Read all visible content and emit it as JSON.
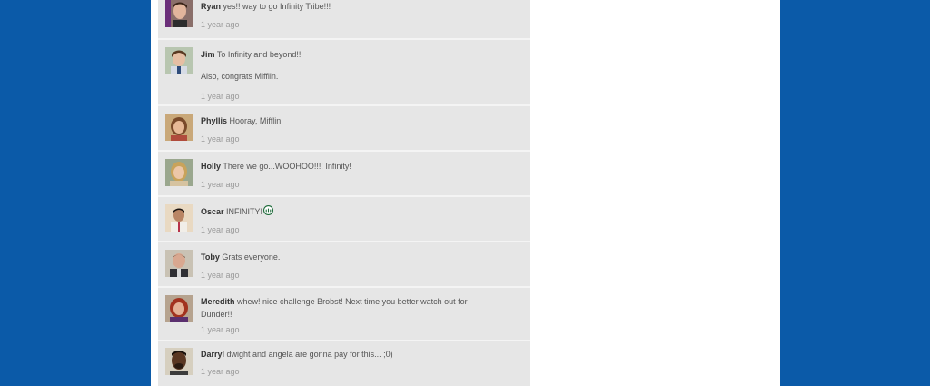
{
  "comments": [
    {
      "name": "Ryan",
      "text": "yes!! way to go Infinity Tribe!!!",
      "time": "1 year ago"
    },
    {
      "name": "Jim",
      "text": "To Infinity and beyond!!",
      "extra": "Also, congrats Mifflin.",
      "time": "1 year ago"
    },
    {
      "name": "Phyllis",
      "text": "Hooray, Mifflin!",
      "time": "1 year ago"
    },
    {
      "name": "Holly",
      "text": "There we go...WOOHOO!!!! Infinity!",
      "time": "1 year ago"
    },
    {
      "name": "Oscar",
      "text": "INFINITY!",
      "time": "1 year ago",
      "icon": "infinity-emblem-icon"
    },
    {
      "name": "Toby",
      "text": "Grats everyone.",
      "time": "1 year ago"
    },
    {
      "name": "Meredith",
      "text": "whew!  nice challenge Brobst!  Next time you better watch out for Dunder!!",
      "time": "1 year ago"
    },
    {
      "name": "Darryl",
      "text": "dwight and angela are gonna pay for this... ;0)",
      "time": "1 year ago"
    }
  ],
  "colors": {
    "background": "#0b5aa8",
    "panel": "#ffffff",
    "comment_bg": "#e6e6e6"
  }
}
